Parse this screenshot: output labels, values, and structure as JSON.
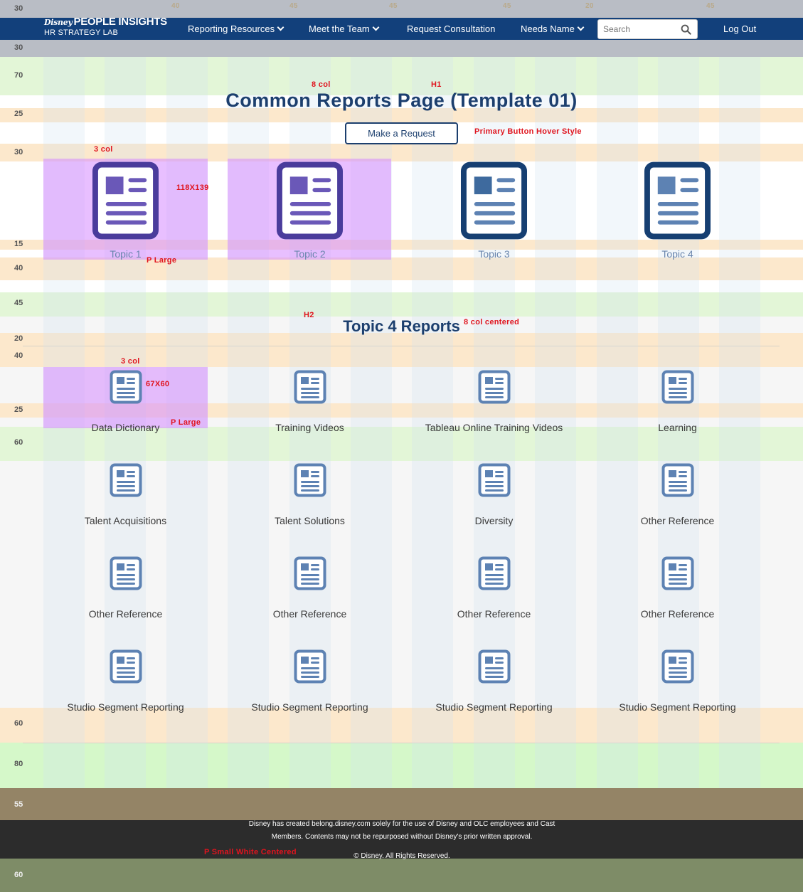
{
  "brand": {
    "script": "Disney",
    "name": "PEOPLE INSIGHTS",
    "sub": "HR STRATEGY LAB"
  },
  "nav": {
    "items": [
      {
        "label": "Reporting Resources",
        "dropdown": true
      },
      {
        "label": "Meet the Team",
        "dropdown": true
      },
      {
        "label": "Request Consultation",
        "dropdown": false
      },
      {
        "label": "Needs Name",
        "dropdown": true
      }
    ],
    "search_placeholder": "Search",
    "logout": "Log Out"
  },
  "spacing": {
    "s1": "30",
    "s2": "30",
    "s3": "70",
    "s4": "25",
    "s5": "30",
    "s6": "15",
    "s7": "40",
    "s8": "45",
    "s9": "20",
    "s10": "40",
    "s11": "25",
    "s12": "60",
    "s13": "60",
    "s14": "80",
    "s15": "55",
    "s16": "60"
  },
  "ruler": {
    "r1": "40",
    "r2": "45",
    "r3": "45",
    "r4": "45",
    "r5": "20",
    "r6": "45"
  },
  "annotations": {
    "h1_cols": "8 col",
    "h1_tag": "H1",
    "button_style": "Primary Button Hover Style",
    "topic_cols": "3 col",
    "topic_size": "118X139",
    "topic_p": "P Large",
    "h2_tag": "H2",
    "h2_cols": "8 col centered",
    "rep_cols": "3 col",
    "rep_size": "67X60",
    "rep_p": "P Large",
    "footer_p": "P Small White Centered"
  },
  "page": {
    "title": "Common Reports Page (Template 01)",
    "button": "Make a Request",
    "topics": [
      "Topic 1",
      "Topic 2",
      "Topic 3",
      "Topic 4"
    ],
    "section_title": "Topic 4 Reports",
    "reports": [
      "Data Dictionary",
      "Training Videos",
      "Tableau Online Training Videos",
      "Learning",
      "Talent Acquisitions",
      "Talent Solutions",
      "Diversity",
      "Other Reference",
      "Other Reference",
      "Other Reference",
      "Other Reference",
      "Other Reference",
      "Studio Segment Reporting",
      "Studio Segment Reporting",
      "Studio Segment Reporting",
      "Studio Segment Reporting"
    ]
  },
  "footer": {
    "line1": "Disney has created belong.disney.com solely for the use of Disney and OLC employees and Cast",
    "line2": "Members. Contents may not be repurposed without Disney's prior written approval.",
    "copyright": "© Disney. All Rights Reserved."
  },
  "colors": {
    "navy": "#12407b",
    "heading": "#1c3f6e",
    "icon": "#5d82b3",
    "highlight": "#d68aff",
    "annotation": "#e0141e"
  }
}
